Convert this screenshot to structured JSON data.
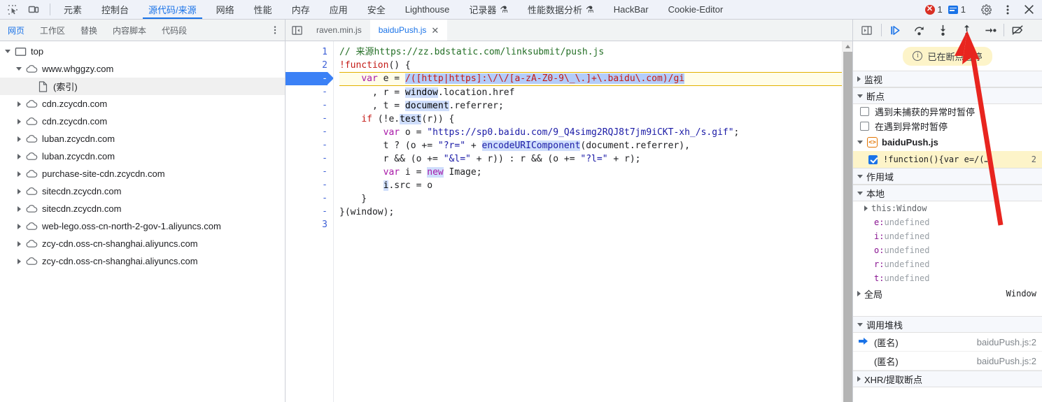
{
  "window": {
    "main_tabs": [
      {
        "label": "元素",
        "active": false
      },
      {
        "label": "控制台",
        "active": false
      },
      {
        "label": "源代码/来源",
        "active": true
      },
      {
        "label": "网络",
        "active": false
      },
      {
        "label": "性能",
        "active": false
      },
      {
        "label": "内存",
        "active": false
      },
      {
        "label": "应用",
        "active": false
      },
      {
        "label": "安全",
        "active": false
      },
      {
        "label": "Lighthouse",
        "active": false
      },
      {
        "label": "记录器",
        "active": false,
        "flask": true
      },
      {
        "label": "性能数据分析",
        "active": false,
        "flask": true
      },
      {
        "label": "HackBar",
        "active": false
      },
      {
        "label": "Cookie-Editor",
        "active": false
      }
    ],
    "error_count": "1",
    "message_count": "1",
    "icons": {
      "inspect": "inspect-element-icon",
      "device": "device-toolbar-icon",
      "settings": "gear-icon",
      "more": "more-options-icon",
      "close": "close-icon"
    }
  },
  "sources": {
    "sub_tabs": [
      {
        "label": "网页",
        "active": true
      },
      {
        "label": "工作区",
        "active": false
      },
      {
        "label": "替换",
        "active": false
      },
      {
        "label": "内容脚本",
        "active": false
      },
      {
        "label": "代码段",
        "active": false
      }
    ],
    "file_tree": [
      {
        "label": "top",
        "indent": 0,
        "twisty": "down",
        "icon": "frame-icon",
        "selected": false
      },
      {
        "label": "www.whggzy.com",
        "indent": 1,
        "twisty": "down",
        "icon": "cloud-icon",
        "selected": false
      },
      {
        "label": "(索引)",
        "indent": 2,
        "twisty": "none",
        "icon": "document-icon",
        "selected": true
      },
      {
        "label": "cdn.zcycdn.com",
        "indent": 1,
        "twisty": "right",
        "icon": "cloud-icon",
        "selected": false
      },
      {
        "label": "cdn.zcycdn.com",
        "indent": 1,
        "twisty": "right",
        "icon": "cloud-icon",
        "selected": false
      },
      {
        "label": "luban.zcycdn.com",
        "indent": 1,
        "twisty": "right",
        "icon": "cloud-icon",
        "selected": false
      },
      {
        "label": "luban.zcycdn.com",
        "indent": 1,
        "twisty": "right",
        "icon": "cloud-icon",
        "selected": false
      },
      {
        "label": "purchase-site-cdn.zcycdn.com",
        "indent": 1,
        "twisty": "right",
        "icon": "cloud-icon",
        "selected": false
      },
      {
        "label": "sitecdn.zcycdn.com",
        "indent": 1,
        "twisty": "right",
        "icon": "cloud-icon",
        "selected": false
      },
      {
        "label": "sitecdn.zcycdn.com",
        "indent": 1,
        "twisty": "right",
        "icon": "cloud-icon",
        "selected": false
      },
      {
        "label": "web-lego.oss-cn-north-2-gov-1.aliyuncs.com",
        "indent": 1,
        "twisty": "right",
        "icon": "cloud-icon",
        "selected": false
      },
      {
        "label": "zcy-cdn.oss-cn-shanghai.aliyuncs.com",
        "indent": 1,
        "twisty": "right",
        "icon": "cloud-icon",
        "selected": false
      },
      {
        "label": "zcy-cdn.oss-cn-shanghai.aliyuncs.com",
        "indent": 1,
        "twisty": "right",
        "icon": "cloud-icon",
        "selected": false
      }
    ],
    "editor_tabs": [
      {
        "label": "raven.min.js",
        "active": false,
        "closable": false
      },
      {
        "label": "baiduPush.js",
        "active": true,
        "closable": true,
        "close_label": "✕"
      }
    ]
  },
  "editor": {
    "gutter": [
      "1",
      "2",
      "-",
      "-",
      "-",
      "-",
      "-",
      "-",
      "-",
      "-",
      "-",
      "-",
      "-",
      "3"
    ],
    "exec_line_index": 2,
    "breakpoint_line_index": 2,
    "code_lines": [
      "// 来源https://zz.bdstatic.com/linksubmit/push.js",
      "!function() {",
      "    var e = /([http|https]:\\/\\/[a-zA-Z0-9\\_\\.]+\\.baidu\\.com)/gi",
      "      , r = window.location.href",
      "      , t = document.referrer;",
      "    if (!e.test(r)) {",
      "        var o = \"https://sp0.baidu.com/9_Q4simg2RQJ8t7jm9iCKT-xh_/s.gif\";",
      "        t ? (o += \"?r=\" + encodeURIComponent(document.referrer),",
      "        r && (o += \"&l=\" + r)) : r && (o += \"?l=\" + r);",
      "        var i = new Image;",
      "        i.src = o",
      "    }",
      "}(window);",
      ""
    ]
  },
  "debugger": {
    "toolbar_buttons": [
      {
        "name": "resume-script-execution",
        "glyph": "resume"
      },
      {
        "name": "step-over-next-function-call",
        "glyph": "step-over"
      },
      {
        "name": "step-into-next-function-call",
        "glyph": "step-into"
      },
      {
        "name": "step-out-of-current-function",
        "glyph": "step-out"
      },
      {
        "name": "step",
        "glyph": "step"
      },
      {
        "name": "deactivate-breakpoints",
        "glyph": "deactivate-breakpoints"
      }
    ],
    "paused_banner": "已在断点暂停",
    "sections": {
      "watch": "监视",
      "breakpoints": "断点",
      "scope": "作用域",
      "local": "本地",
      "call_stack": "调用堆栈",
      "xhr_breakpoints": "XHR/提取断点"
    },
    "pause_options": [
      {
        "label": "遇到未捕获的异常时暂停",
        "checked": false
      },
      {
        "label": "在遇到异常时暂停",
        "checked": false
      }
    ],
    "breakpoint_group": {
      "file": "baiduPush.js",
      "items": [
        {
          "code": "!function(){var e=/(…",
          "line": "2",
          "checked": true
        }
      ]
    },
    "scope_vars": [
      {
        "name": "this",
        "value": "Window",
        "expandable": true
      },
      {
        "name": "e",
        "value": "undefined",
        "expandable": false
      },
      {
        "name": "i",
        "value": "undefined",
        "expandable": false
      },
      {
        "name": "o",
        "value": "undefined",
        "expandable": false
      },
      {
        "name": "r",
        "value": "undefined",
        "expandable": false
      },
      {
        "name": "t",
        "value": "undefined",
        "expandable": false
      }
    ],
    "global_scope": {
      "label": "全局",
      "value": "Window"
    },
    "call_stack": [
      {
        "name": "(匿名)",
        "source": "baiduPush.js:2",
        "current": true
      },
      {
        "name": "(匿名)",
        "source": "baiduPush.js:2",
        "current": false
      }
    ]
  },
  "annotation": {
    "arrow_color": "#e8251f",
    "points_to": "step-button"
  }
}
